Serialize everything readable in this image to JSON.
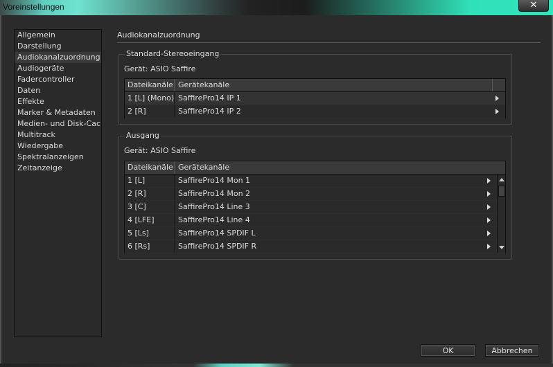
{
  "window": {
    "title": "Voreinstellungen",
    "close_glyph": "✕"
  },
  "sidebar": {
    "items": [
      {
        "label": "Allgemein",
        "selected": false
      },
      {
        "label": "Darstellung",
        "selected": false
      },
      {
        "label": "Audiokanalzuordnung",
        "selected": true
      },
      {
        "label": "Audiogeräte",
        "selected": false
      },
      {
        "label": "Fadercontroller",
        "selected": false
      },
      {
        "label": "Daten",
        "selected": false
      },
      {
        "label": "Effekte",
        "selected": false
      },
      {
        "label": "Marker & Metadaten",
        "selected": false
      },
      {
        "label": "Medien- und Disk-Cache",
        "selected": false
      },
      {
        "label": "Multitrack",
        "selected": false
      },
      {
        "label": "Wiedergabe",
        "selected": false
      },
      {
        "label": "Spektralanzeigen",
        "selected": false
      },
      {
        "label": "Zeitanzeige",
        "selected": false
      }
    ]
  },
  "main": {
    "title": "Audiokanalzuordnung",
    "stereo_input": {
      "group_label": "Standard-Stereoeingang",
      "device": "Gerät: ASIO Saffire",
      "columns": [
        "Dateikanäle",
        "Gerätekanäle"
      ],
      "rows": [
        {
          "file": "1 [L] (Mono)",
          "device": "SaffirePro14 IP 1"
        },
        {
          "file": "2 [R]",
          "device": "SaffirePro14 IP 2"
        }
      ]
    },
    "output": {
      "group_label": "Ausgang",
      "device": "Gerät: ASIO Saffire",
      "columns": [
        "Dateikanäle",
        "Gerätekanäle"
      ],
      "rows": [
        {
          "file": "1 [L]",
          "device": "SaffirePro14 Mon 1"
        },
        {
          "file": "2 [R]",
          "device": "SaffirePro14 Mon 2"
        },
        {
          "file": "3 [C]",
          "device": "SaffirePro14 Line 3"
        },
        {
          "file": "4 [LFE]",
          "device": "SaffirePro14 Line 4"
        },
        {
          "file": "5 [Ls]",
          "device": "SaffirePro14 SPDIF L"
        },
        {
          "file": "6 [Rs]",
          "device": "SaffirePro14 SPDIF R"
        }
      ]
    }
  },
  "footer": {
    "ok_label": "OK",
    "cancel_label": "Abbrechen"
  },
  "icons": {
    "arrow": "chevron-right-icon",
    "scroll_up": "scroll-up-icon",
    "scroll_down": "scroll-down-icon",
    "close": "close-icon"
  }
}
